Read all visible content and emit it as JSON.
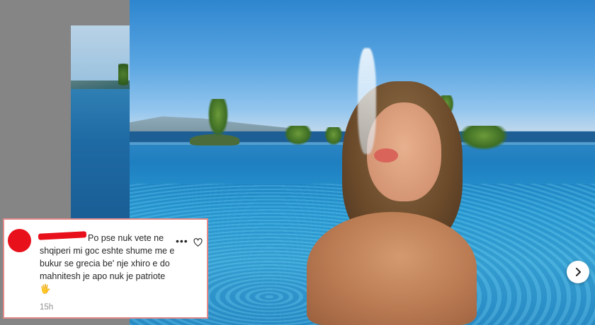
{
  "comment": {
    "text": "Po pse nuk vete ne shqiperi mi goc eshte shume me e bukur se grecia be' nje xhiro e do mahnitesh je apo nuk je patriote 🖐",
    "time": "15h"
  },
  "icons": {
    "more": "more-horizontal-icon",
    "like": "heart-outline-icon",
    "next": "chevron-right-icon"
  },
  "colors": {
    "redaction": "#e8101a",
    "comment_border": "#e28a8a"
  }
}
